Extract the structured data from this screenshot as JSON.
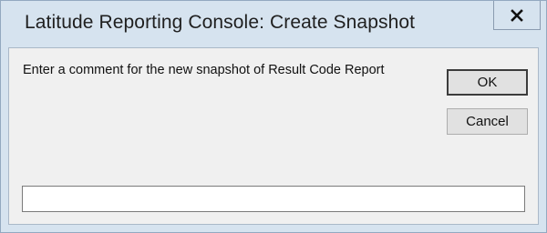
{
  "window": {
    "title": "Latitude Reporting Console: Create Snapshot",
    "close_icon": "close-icon"
  },
  "dialog": {
    "prompt": "Enter a comment for the new snapshot of Result Code Report",
    "ok_label": "OK",
    "cancel_label": "Cancel",
    "comment_value": "",
    "comment_placeholder": ""
  },
  "colors": {
    "titlebar": "#d6e3ef",
    "client_background": "#f0f0f0",
    "button_face": "#e1e1e1"
  }
}
